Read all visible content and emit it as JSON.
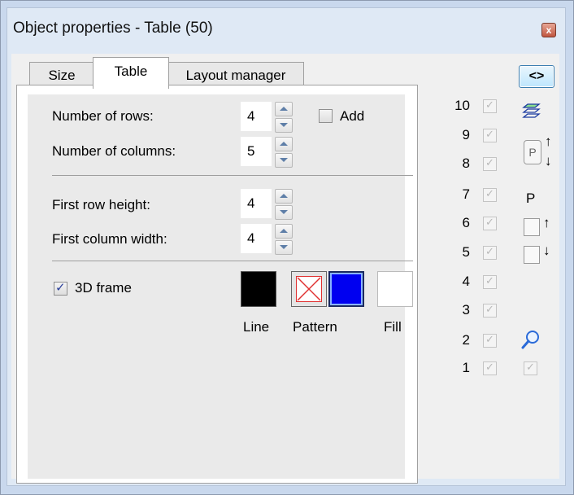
{
  "window": {
    "title": "Object properties - Table (50)",
    "close_label": "x"
  },
  "tabs": [
    {
      "label": "Size",
      "active": false
    },
    {
      "label": "Table",
      "active": true
    },
    {
      "label": "Layout manager",
      "active": false
    }
  ],
  "form": {
    "rows": {
      "label": "Number of rows:",
      "value": "4"
    },
    "columns": {
      "label": "Number of columns:",
      "value": "5"
    },
    "add": {
      "label": "Add",
      "checked": false
    },
    "row_height": {
      "label": "First row height:",
      "value": "4"
    },
    "col_width": {
      "label": "First column width:",
      "value": "4"
    },
    "frame3d": {
      "label": "3D frame",
      "checked": true
    },
    "swatch_labels": {
      "line": "Line",
      "pattern": "Pattern",
      "fill": "Fill"
    },
    "colors": {
      "line": "#000000",
      "pattern_color": "#0000f0",
      "fill": "#ffffff"
    }
  },
  "side": {
    "toggle_label": "<>",
    "layers": [
      "10",
      "9",
      "8",
      "7",
      "6",
      "5",
      "4",
      "3",
      "2",
      "1"
    ],
    "p_box": "P",
    "p_label": "P",
    "up_arrow": "↑",
    "down_arrow": "↓",
    "icons": [
      "layers-icon",
      "bring-forward-icon",
      "zoom-icon"
    ]
  }
}
